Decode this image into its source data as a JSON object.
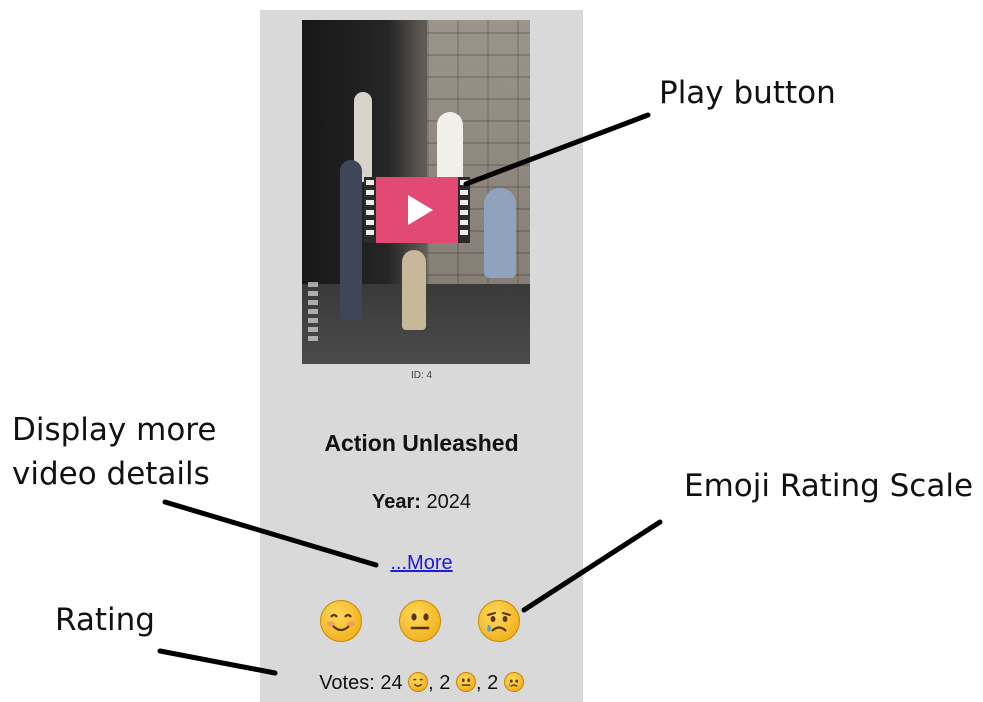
{
  "card": {
    "video_id": "ID: 4",
    "title": "Action Unleashed",
    "year_label": "Year:",
    "year_value": "2024",
    "more_link": "...More",
    "play_icon": "film-play-icon",
    "rating_emojis": [
      {
        "name": "smiling-face-icon",
        "meaning": "happy"
      },
      {
        "name": "neutral-face-icon",
        "meaning": "neutral"
      },
      {
        "name": "crying-face-icon",
        "meaning": "sad"
      }
    ],
    "votes": {
      "label": "Votes:",
      "happy": "24",
      "neutral": "2",
      "sad": "2",
      "sep1": ",",
      "sep2": ","
    }
  },
  "annotations": {
    "play_button": "Play button",
    "more_details_line1": "Display more",
    "more_details_line2": "video details",
    "emoji_scale": "Emoji Rating Scale",
    "rating": "Rating"
  },
  "colors": {
    "card_bg": "#d9d9d9",
    "play_bg": "#e24a74",
    "link": "#1b1bd8",
    "emoji": "#f2b21f"
  }
}
